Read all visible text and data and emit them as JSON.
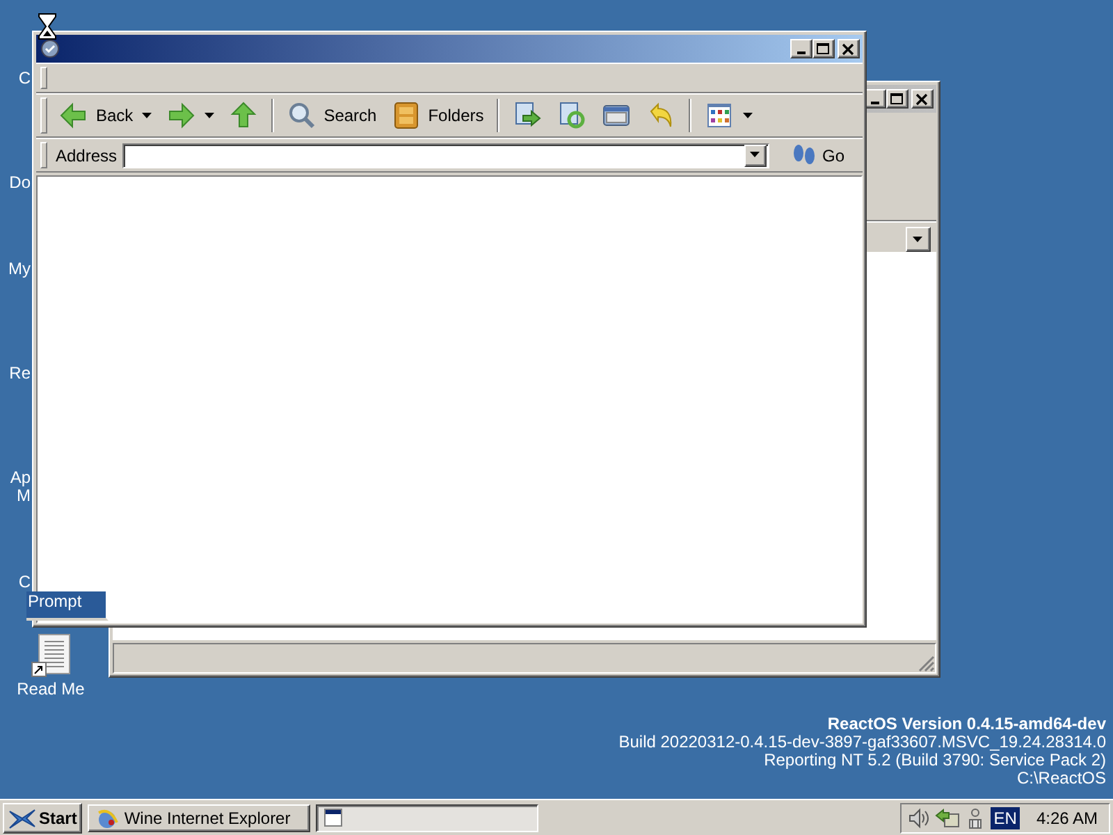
{
  "desktop": {
    "icons": [
      {
        "lines": [
          "C"
        ],
        "selected": false,
        "kind": "hidden"
      },
      {
        "lines": [
          "Do"
        ],
        "selected": false,
        "kind": "hidden"
      },
      {
        "lines": [
          "My"
        ],
        "selected": false,
        "kind": "hidden"
      },
      {
        "lines": [
          "Re"
        ],
        "selected": false,
        "kind": "hidden"
      },
      {
        "lines": [
          "Ap",
          "M"
        ],
        "selected": false,
        "kind": "hidden"
      },
      {
        "lines": [
          "C",
          "Prompt"
        ],
        "selected": true,
        "kind": "partial"
      },
      {
        "lines": [
          "Read Me"
        ],
        "selected": false,
        "kind": "document"
      }
    ],
    "version_info": {
      "title": "ReactOS Version 0.4.15-amd64-dev",
      "lines": [
        "Build 20220312-0.4.15-dev-3897-gaf33607.MSVC_19.24.28314.0",
        "Reporting NT 5.2 (Build 3790: Service Pack 2)",
        "C:\\ReactOS"
      ]
    }
  },
  "back_window": {
    "active": false
  },
  "front_window": {
    "active": true,
    "toolbar": [
      {
        "kind": "back",
        "label": "Back",
        "dropdown": true
      },
      {
        "kind": "forward",
        "dropdown": true
      },
      {
        "kind": "up",
        "dropdown": false
      },
      {
        "kind": "separator"
      },
      {
        "kind": "search",
        "label": "Search",
        "dropdown": false
      },
      {
        "kind": "folders",
        "label": "Folders",
        "dropdown": false
      },
      {
        "kind": "separator"
      },
      {
        "kind": "move_to",
        "dropdown": false
      },
      {
        "kind": "copy_to",
        "dropdown": false
      },
      {
        "kind": "delete",
        "dropdown": false
      },
      {
        "kind": "undo",
        "dropdown": false
      },
      {
        "kind": "separator"
      },
      {
        "kind": "views",
        "dropdown": true
      }
    ],
    "address": {
      "label": "Address",
      "go": "Go"
    }
  },
  "taskbar": {
    "start": "Start",
    "tasks": [
      {
        "kind": "browser",
        "label": "Wine Internet Explorer",
        "selected": false
      },
      {
        "kind": "window",
        "selected": true
      }
    ],
    "tray": {
      "language": "EN",
      "clock": "4:26 AM"
    }
  }
}
